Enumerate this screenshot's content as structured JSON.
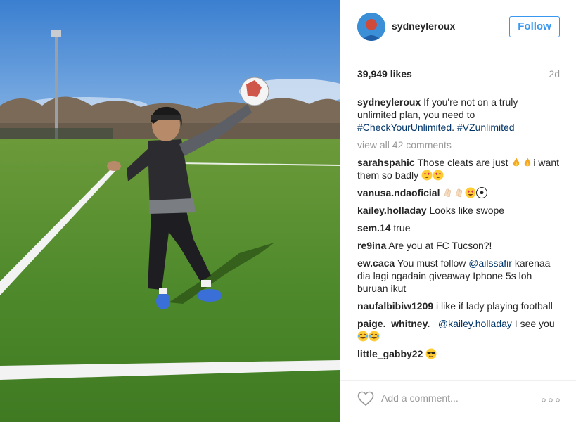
{
  "post": {
    "username": "sydneyleroux",
    "follow_label": "Follow",
    "likes": "39,949 likes",
    "time": "2d",
    "caption": {
      "user": "sydneyleroux",
      "text": "If you're not on a truly unlimited plan, you need to",
      "tag1": "#CheckYourUnlimited",
      "sep": ".",
      "tag2": "#VZunlimited"
    },
    "view_all": "view all 42 comments"
  },
  "comments": [
    {
      "user": "sarahspahic",
      "text": "Those cleats are just",
      "text2": "i want them so badly"
    },
    {
      "user": "vanusa.ndaoficial"
    },
    {
      "user": "kailey.holladay",
      "text": "Looks like swope"
    },
    {
      "user": "sem.14",
      "text": "true"
    },
    {
      "user": "re9ina",
      "text": "Are you at FC Tucson?!"
    },
    {
      "user": "ew.caca",
      "text": "You must follow",
      "mention": "@ailssafir",
      "text2": "karenaa dia lagi ngadain giveaway Iphone 5s loh buruan ikut"
    },
    {
      "user": "naufalbibiw1209",
      "text": "i like if lady playing football"
    },
    {
      "user": "paige._whitney._",
      "mention": "@kailey.holladay",
      "text": "I see you"
    },
    {
      "user": "little_gabby22"
    }
  ],
  "footer": {
    "add_comment_placeholder": "Add a comment..."
  },
  "icons": {
    "heart": "heart-outline-icon",
    "more": "more-options-icon",
    "fire": "fire-emoji",
    "heart_eyes": "heart-eyes-emoji",
    "clap": "clapping-hands-emoji",
    "soccer": "soccer-ball-emoji",
    "joy": "tears-of-joy-emoji",
    "cool": "sunglasses-emoji"
  },
  "colors": {
    "accent": "#3897f0",
    "hashtag": "#003569",
    "muted": "#999999",
    "text": "#262626"
  }
}
